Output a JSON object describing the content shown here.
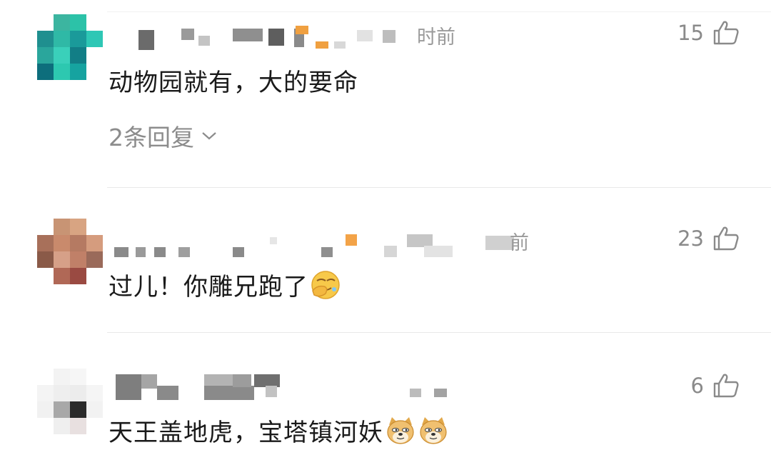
{
  "comments": [
    {
      "time": "时前",
      "likes": "15",
      "text": "动物园就有，大的要命",
      "replies": "2条回复"
    },
    {
      "time": "前",
      "likes": "23",
      "text": "过儿！你雕兄跑了"
    },
    {
      "likes": "6",
      "text": "天王盖地虎，宝塔镇河妖"
    }
  ],
  "icons": {
    "like": "thumbs-up-icon",
    "expand": "chevron-down-icon",
    "emoji_facepalm": "facepalm-emoji",
    "emoji_doge": "doge-emoji"
  },
  "colors": {
    "text": "#1a1a1a",
    "meta": "#8c8c8c",
    "divider": "#e9e9e9"
  }
}
